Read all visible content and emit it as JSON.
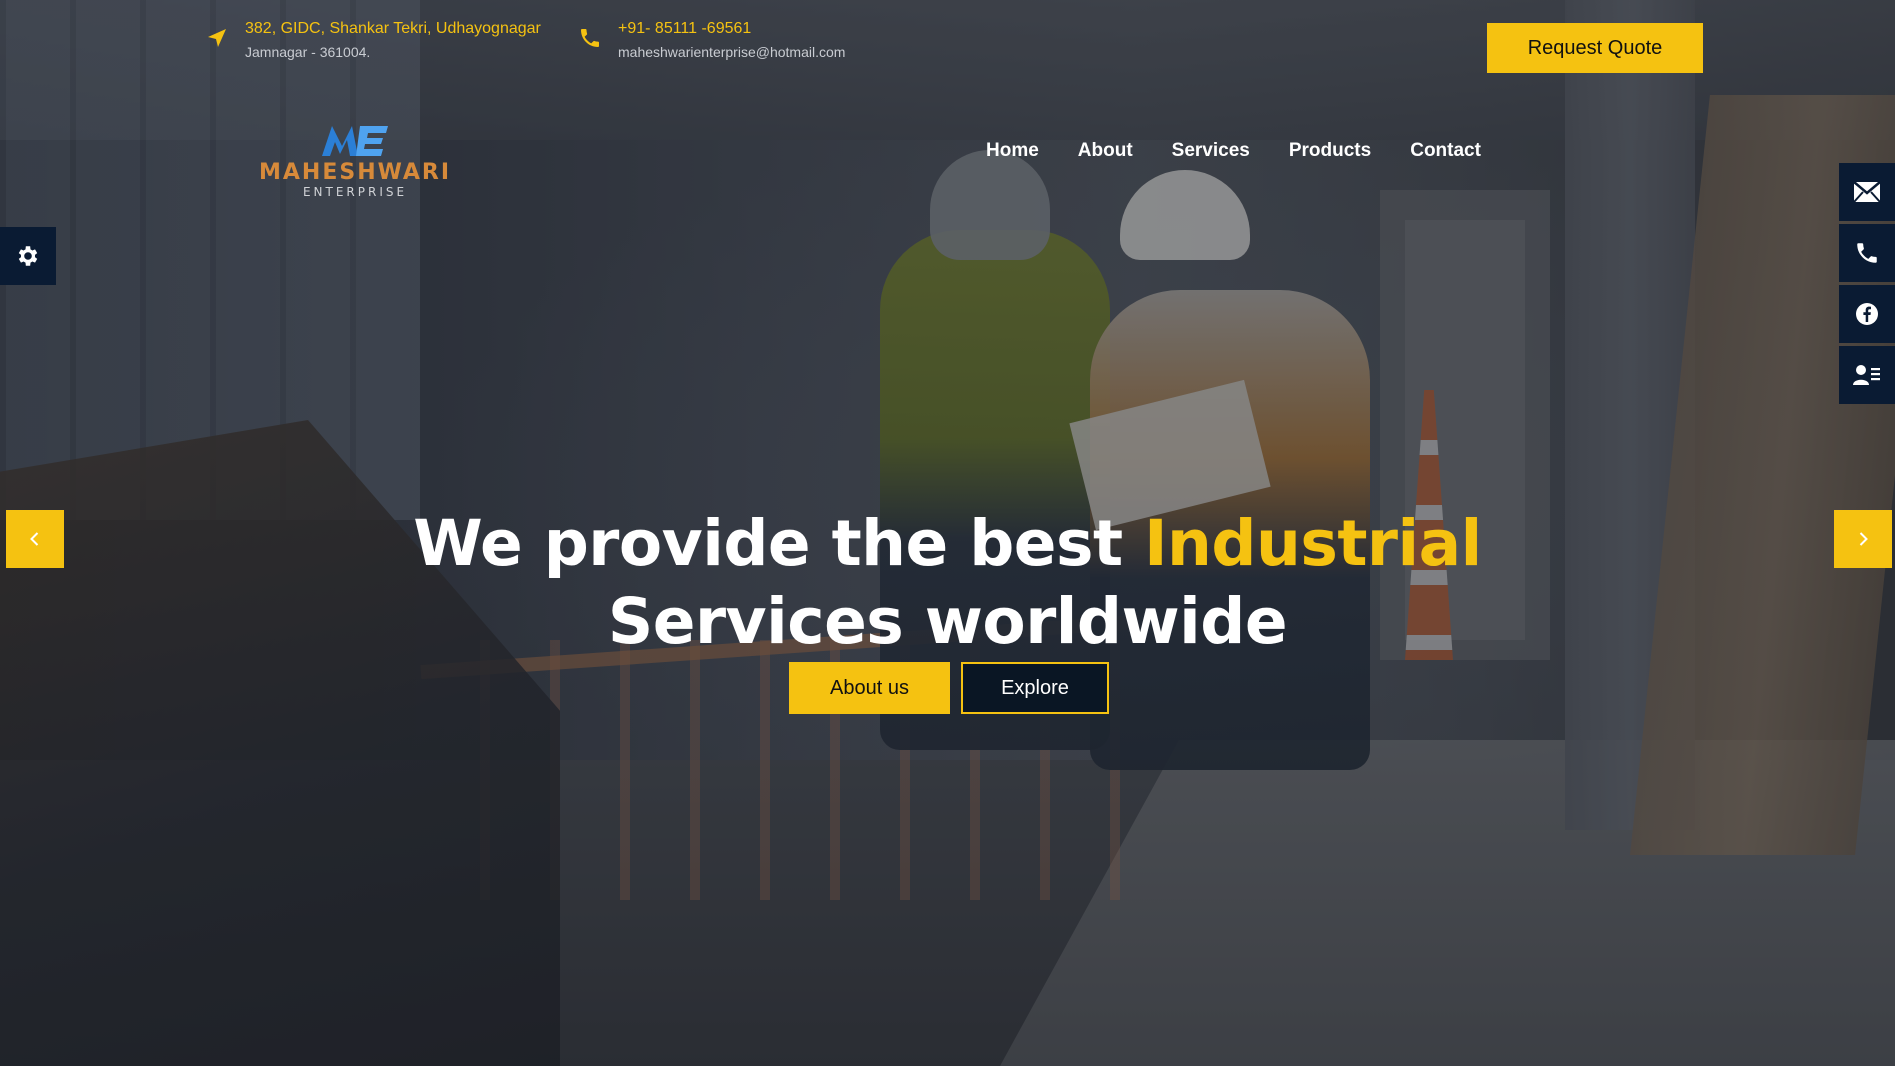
{
  "topbar": {
    "address": {
      "icon": "location-arrow-icon",
      "line1": "382, GIDC, Shankar Tekri, Udhayognagar",
      "line2": "Jamnagar - 361004."
    },
    "phone": {
      "icon": "phone-icon",
      "line1": "+91- 85111 -69561",
      "line2": "maheshwarienterprise@hotmail.com"
    },
    "request_quote_label": "Request Quote"
  },
  "logo": {
    "name": "MAHESHWARI",
    "sub": "ENTERPRISE"
  },
  "nav": {
    "items": [
      {
        "label": "Home"
      },
      {
        "label": "About"
      },
      {
        "label": "Services"
      },
      {
        "label": "Products"
      },
      {
        "label": "Contact"
      }
    ]
  },
  "side_rail": {
    "items": [
      "mail-icon",
      "phone-icon",
      "facebook-icon",
      "contact-card-icon"
    ]
  },
  "settings_icon": "gear-icon",
  "hero": {
    "headline_part1": "We provide the best",
    "headline_accent": "Industrial",
    "headline_part2": "Services worldwide",
    "primary_cta": "About us",
    "secondary_cta": "Explore"
  },
  "colors": {
    "accent": "#f5c211",
    "dark": "#0a1b33",
    "text": "#ffffff"
  }
}
